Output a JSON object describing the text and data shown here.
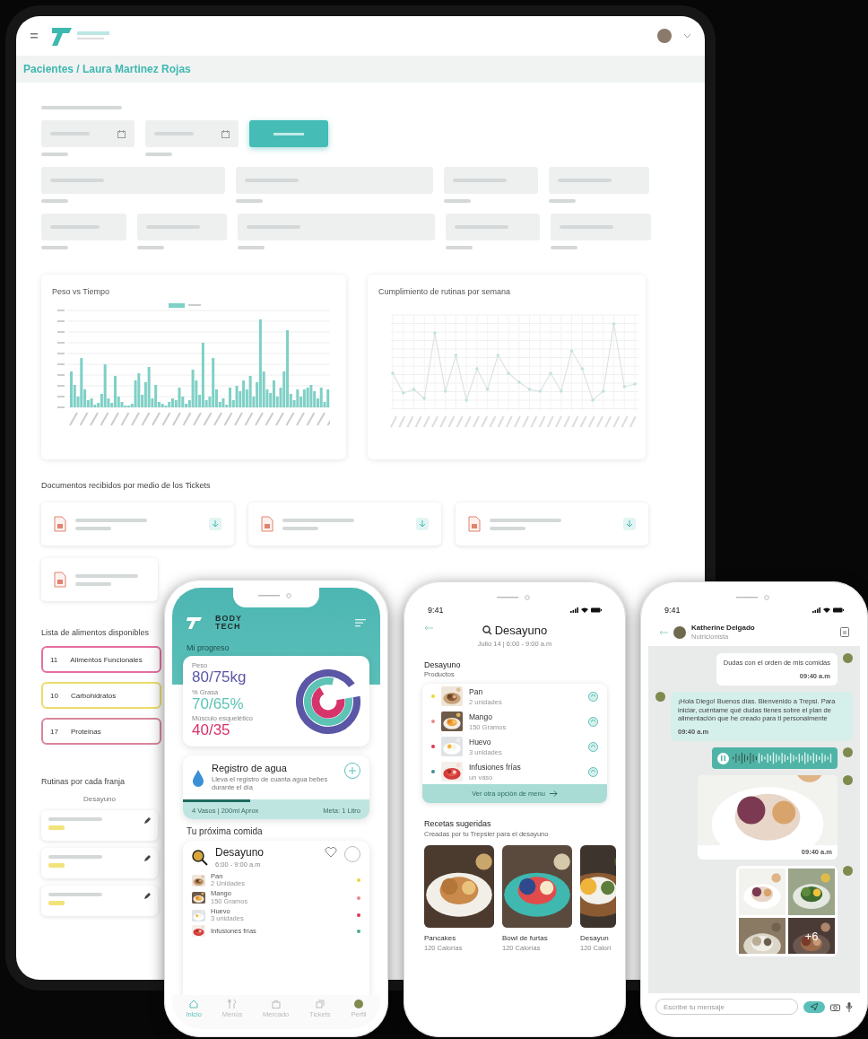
{
  "tablet": {
    "breadcrumb": "Pacientes / Laura Martinez Rojas",
    "charts": [
      {
        "title": "Peso vs Tiempo",
        "kind": "bar"
      },
      {
        "title": "Cumplimiento de rutinas por semana",
        "kind": "line"
      }
    ],
    "documents_title": "Documentos recibidos por medio de los Tickets",
    "food_list_title": "Lista de alimentos disponibles",
    "food_groups": [
      {
        "count": "11",
        "name": "Alimentos Funcionales",
        "color": "#e46fa0"
      },
      {
        "count": "10",
        "name": "Carbohidratos",
        "color": "#ecdc6a"
      },
      {
        "count": "17",
        "name": "Proteinas",
        "color": "#d9869b"
      }
    ],
    "routines_title": "Rutinas por cada franja",
    "routine_column": "Desayuno"
  },
  "home": {
    "brand": "BODY TECH",
    "section": "Mi progreso",
    "metrics": [
      {
        "label": "Peso",
        "value": "80/75kg",
        "color": "#5b57a6"
      },
      {
        "label": "% Grasa",
        "value": "70/65%",
        "color": "#5cc3b5"
      },
      {
        "label": "Músculo esquelético",
        "value": "40/35",
        "color": "#d6336c"
      }
    ],
    "water": {
      "title": "Registro de agua",
      "text": "Lleva el registro de cuanta agua bebes durante el día",
      "level": 0.36,
      "amount": "4 Vasos | 200ml Aprox",
      "goal": "Meta: 1 Litro"
    },
    "next_meal_title": "Tu próxima comida",
    "meal": {
      "name": "Desayuno",
      "time": "6:00 - 9:00 a.m",
      "favorite": false,
      "done": false,
      "items": [
        {
          "name": "Pan",
          "qty": "2 Unidades",
          "color": "#f2d23c"
        },
        {
          "name": "Mango",
          "qty": "150 Gramos",
          "color": "#e88a8a"
        },
        {
          "name": "Huevo",
          "qty": "3 unidades",
          "color": "#d9374f"
        },
        {
          "name": "Infusiones frías",
          "color": "#3fae8f"
        }
      ]
    },
    "tabs": [
      {
        "label": "Inicio",
        "selected": true
      },
      {
        "label": "Menús",
        "selected": false
      },
      {
        "label": "Mercado",
        "selected": false
      },
      {
        "label": "Tickets",
        "selected": false
      },
      {
        "label": "Perfil",
        "selected": false
      }
    ]
  },
  "menu": {
    "time": "9:41",
    "title": "Desayuno",
    "subtitle": "Julio 14 | 6:00 - 9:00 a.m",
    "section": "Desayuno",
    "section_sub": "Productos",
    "products": [
      {
        "name": "Pan",
        "qty": "2 unidades",
        "color": "#e6dc3c"
      },
      {
        "name": "Mango",
        "qty": "150 Gramos",
        "color": "#e88a8a"
      },
      {
        "name": "Huevo",
        "qty": "3 unidades",
        "color": "#d9374f"
      },
      {
        "name": "Infusiones frías",
        "qty": "un vaso",
        "color": "#3f8f8a"
      }
    ],
    "button": "Ver otra opción de menu",
    "recipes_title": "Recetas sugeridas",
    "recipes_sub": "Creadas por tu Trepsier para el desayuno",
    "recipes": [
      {
        "name": "Pancakes",
        "calories": "120 Calorías"
      },
      {
        "name": "Bowl de furtas",
        "calories": "120 Calorías"
      },
      {
        "name": "Desayun",
        "calories": "120 Calori"
      }
    ]
  },
  "chat": {
    "time": "9:41",
    "contact": "Katherine Delgado",
    "role": "Nutricionista",
    "messages": [
      {
        "kind": "text",
        "outgoing": true,
        "text": "Dudas con el orden de mis comidas",
        "time": "09:40 a.m"
      },
      {
        "kind": "text",
        "outgoing": false,
        "text": "¡Hola Diego! Buenos días. Bienvenido a Trepsi. Para iniciar, cuéntame qué dudas tienes sobre el plan de alimentación que he creado para ti personalmente",
        "time": "09:40 a.m"
      },
      {
        "kind": "voice",
        "outgoing": true,
        "level": 0.25
      },
      {
        "outgoing": true,
        "time": "09:40 a.m"
      },
      {
        "kind": "gallery",
        "outgoing": true,
        "more": "+6"
      }
    ],
    "placeholder": "Escribe tu mensaje"
  }
}
